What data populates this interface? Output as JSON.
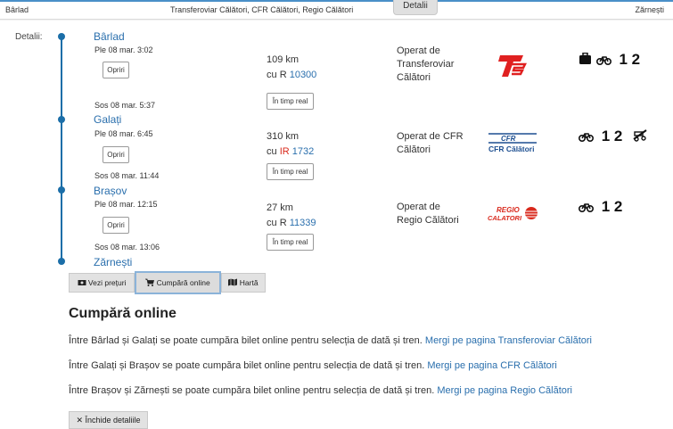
{
  "topbar": {
    "from": "Bârlad",
    "operators": "Transferoviar Călători, CFR Călători, Regio Călători",
    "to": "Zărnești",
    "tab": "Detalii"
  },
  "details_label": "Detalii:",
  "stations": [
    "Bârlad",
    "Galați",
    "Brașov",
    "Zărnești"
  ],
  "segments": [
    {
      "depart": "Ple 08 mar. 3:02",
      "arrive": "Sos 08 mar. 5:37",
      "stops_label": "Opriri",
      "distance": "109 km",
      "train_prefix": "cu",
      "train_type": "R",
      "train_number": "10300",
      "realtime_label": "În timp real",
      "operator_l1": "Operat de",
      "operator_l2": "Transferoviar",
      "operator_l3": "Călători",
      "classes": "1  2"
    },
    {
      "depart": "Ple 08 mar. 6:45",
      "arrive": "Sos 08 mar. 11:44",
      "stops_label": "Opriri",
      "distance": "310 km",
      "train_prefix": "cu",
      "train_type": "IR",
      "train_number": "1732",
      "realtime_label": "În timp real",
      "operator_l1": "Operat de CFR",
      "operator_l2": "Călători",
      "classes": "1  2"
    },
    {
      "depart": "Ple 08 mar. 12:15",
      "arrive": "Sos 08 mar. 13:06",
      "stops_label": "Opriri",
      "distance": "27 km",
      "train_prefix": "cu",
      "train_type": "R",
      "train_number": "11339",
      "realtime_label": "În timp real",
      "operator_l1": "Operat de",
      "operator_l2": "Regio Călători",
      "classes": "1  2"
    }
  ],
  "logos": {
    "cfr_top": "CFR",
    "cfr_bottom": "CFR Călători",
    "regio_top": "REGIO",
    "regio_bottom": "CALATORI"
  },
  "actions": {
    "prices": "Vezi prețuri",
    "buy": "Cumpără online",
    "map": "Hartă"
  },
  "online": {
    "heading": "Cumpără online",
    "lines": [
      {
        "text": "Între Bârlad și Galați se poate cumpăra bilet online pentru selecția de dată și tren.",
        "link": "Mergi pe pagina Transferoviar Călători"
      },
      {
        "text": "Între Galați și Brașov se poate cumpăra bilet online pentru selecția de dată și tren.",
        "link": "Mergi pe pagina CFR Călători"
      },
      {
        "text": "Între Brașov și Zărnești se poate cumpăra bilet online pentru selecția de dată și tren.",
        "link": "Mergi pe pagina Regio Călători"
      }
    ],
    "close": "Închide detaliile"
  },
  "colors": {
    "link": "#2a6fad",
    "timeline": "#1b6ea8",
    "ir_red": "#d9291c"
  }
}
